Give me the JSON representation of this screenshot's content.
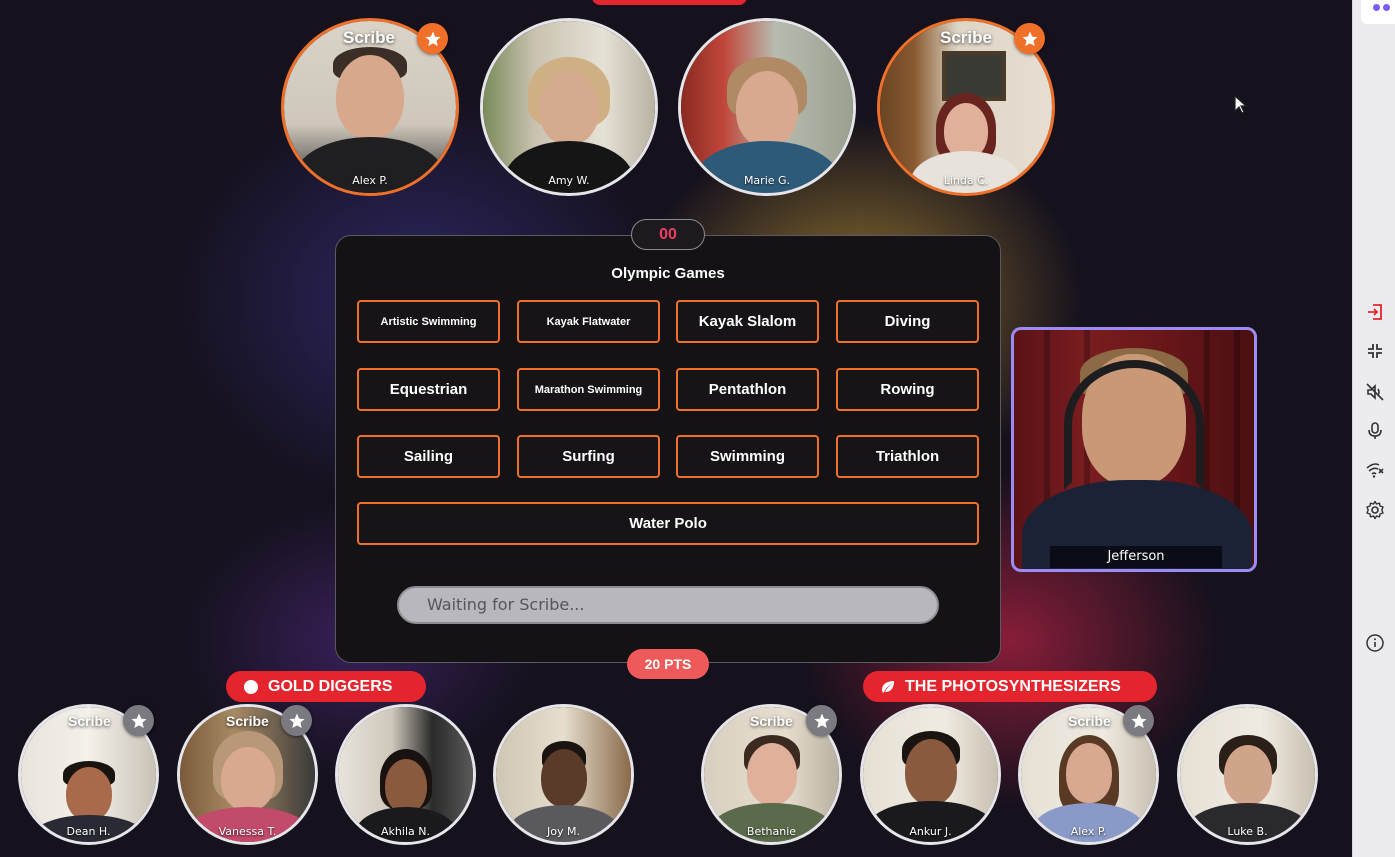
{
  "top_players": [
    {
      "name": "Alex P.",
      "scribe": true,
      "scribe_label": "Scribe"
    },
    {
      "name": "Amy W.",
      "scribe": false
    },
    {
      "name": "Marie G.",
      "scribe": false
    },
    {
      "name": "Linda C.",
      "scribe": true,
      "scribe_label": "Scribe"
    }
  ],
  "board": {
    "timer": "00",
    "title": "Olympic Games",
    "options": [
      "Artistic Swimming",
      "Kayak Flatwater",
      "Kayak Slalom",
      "Diving",
      "Equestrian",
      "Marathon Swimming",
      "Pentathlon",
      "Rowing",
      "Sailing",
      "Surfing",
      "Swimming",
      "Triathlon",
      "Water Polo"
    ],
    "input_placeholder": "Waiting for Scribe...",
    "points": "20 PTS"
  },
  "host": {
    "name": "Jefferson"
  },
  "teams": [
    {
      "name": "GOLD DIGGERS",
      "icon": "dot-icon",
      "color": "#e5252d",
      "players": [
        {
          "name": "Dean H.",
          "scribe": true,
          "scribe_label": "Scribe"
        },
        {
          "name": "Vanessa T.",
          "scribe": true,
          "scribe_label": "Scribe"
        },
        {
          "name": "Akhila N.",
          "scribe": false
        },
        {
          "name": "Joy M.",
          "scribe": false
        }
      ]
    },
    {
      "name": "THE PHOTOSYNTHESIZERS",
      "icon": "leaf-icon",
      "color": "#e5252d",
      "players": [
        {
          "name": "Bethanie",
          "scribe": true,
          "scribe_label": "Scribe"
        },
        {
          "name": "Ankur J.",
          "scribe": false
        },
        {
          "name": "Alex P.",
          "scribe": true,
          "scribe_label": "Scribe"
        },
        {
          "name": "Luke B.",
          "scribe": false
        }
      ]
    }
  ],
  "sidebar_icons": [
    "exit-icon",
    "collapse-icon",
    "sound-off-icon",
    "microphone-icon",
    "wifi-off-icon",
    "settings-icon",
    "info-icon"
  ],
  "colors": {
    "accent": "#f0702a",
    "timer": "#ee3d63",
    "team": "#e5252d",
    "host_border": "#9b8cf5",
    "points": "#ee5a5a"
  }
}
